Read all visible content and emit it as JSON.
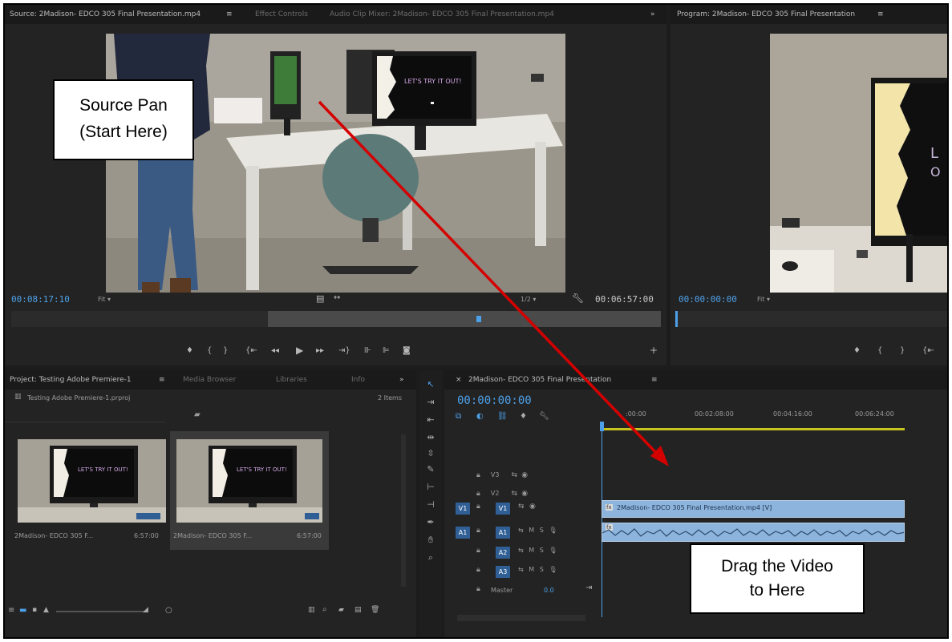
{
  "source_panel": {
    "title": "Source: 2Madison- EDCO 305 Final Presentation.mp4",
    "tabs": [
      "Effect Controls",
      "Audio Clip Mixer: 2Madison- EDCO 305 Final Presentation.mp4"
    ],
    "timecode_in": "00:08:17:10",
    "fit": "Fit",
    "ratio": "1/2",
    "timecode_dur": "00:06:57:00",
    "screen_text": "LET'S TRY IT OUT!"
  },
  "program_panel": {
    "title": "Program: 2Madison- EDCO 305 Final Presentation",
    "timecode": "00:00:00:00",
    "fit": "Fit"
  },
  "project_panel": {
    "tab": "Project: Testing Adobe Premiere-1",
    "tabs": [
      "Media Browser",
      "Libraries",
      "Info"
    ],
    "file": "Testing Adobe Premiere-1.prproj",
    "count": "2 Items",
    "items": [
      {
        "name": "2Madison- EDCO 305 F...",
        "dur": "6:57:00"
      },
      {
        "name": "2Madison- EDCO 305 F...",
        "dur": "6:57:00"
      }
    ],
    "thumb_text": "LET'S TRY IT OUT!"
  },
  "timeline_panel": {
    "title": "2Madison- EDCO 305 Final Presentation",
    "timecode": "00:00:00:00",
    "ruler": [
      ":00:00",
      "00:02:08:00",
      "00:04:16:00",
      "00:06:24:00"
    ],
    "tracks": {
      "v3": "V3",
      "v2": "V2",
      "v1": "V1",
      "a1": "A1",
      "a2": "A2",
      "a3": "A3",
      "master": "Master",
      "master_val": "0.0",
      "src_v": "V1",
      "src_a": "A1",
      "mute": "M",
      "solo": "S"
    },
    "clip_label": "2Madison- EDCO 305 Final Presentation.mp4 [V]",
    "fx": "fx"
  },
  "callouts": {
    "source": [
      "Source Pan",
      "(Start Here)"
    ],
    "drag": [
      "Drag the Video",
      "to Here"
    ]
  },
  "colors": {
    "accent": "#4da0e8",
    "arrow": "#d40000",
    "clip": "#8cb4dc",
    "panel": "#232323"
  }
}
